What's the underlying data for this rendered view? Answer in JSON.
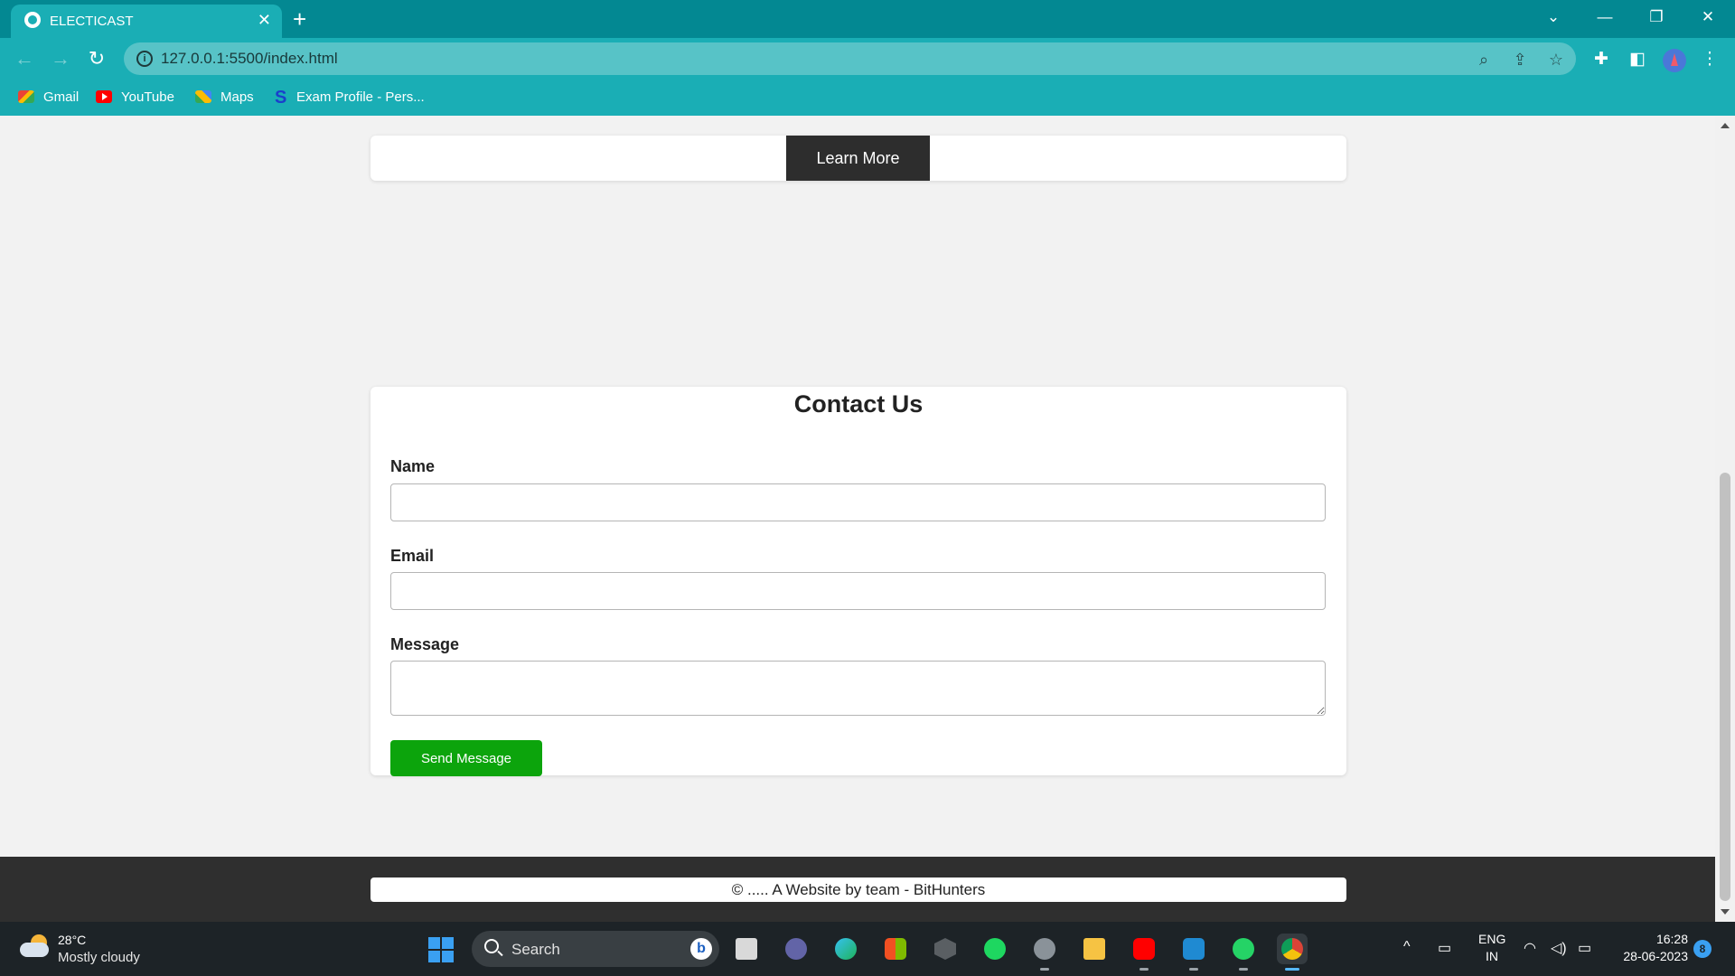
{
  "browser": {
    "tab_title": "ELECTICAST",
    "tab_close": "✕",
    "new_tab": "+",
    "url": "127.0.0.1:5500/index.html",
    "window_controls": {
      "dropdown": "⌄",
      "minimize": "—",
      "restore": "❐",
      "close": "✕"
    },
    "bookmarks": [
      {
        "label": "Gmail",
        "icon": "gmail-icon"
      },
      {
        "label": "YouTube",
        "icon": "youtube-icon"
      },
      {
        "label": "Maps",
        "icon": "maps-icon"
      },
      {
        "label": "Exam Profile - Pers...",
        "icon": "exam-profile-icon"
      }
    ]
  },
  "page": {
    "learn_more_label": "Learn More",
    "contact": {
      "title": "Contact Us",
      "name_label": "Name",
      "name_value": "",
      "email_label": "Email",
      "email_value": "",
      "message_label": "Message",
      "message_value": "",
      "send_label": "Send Message"
    },
    "footer_text": "© ..... A Website by team - BitHunters"
  },
  "taskbar": {
    "weather_temp": "28°C",
    "weather_desc": "Mostly cloudy",
    "search_label": "Search",
    "bing_label": "b",
    "apps": [
      "task-view",
      "teams",
      "edge",
      "store",
      "unity",
      "spotify",
      "settings",
      "file-explorer",
      "youtube",
      "vscode",
      "whatsapp",
      "chrome"
    ],
    "tray_chevron": "^",
    "lang_top": "ENG",
    "lang_bottom": "IN",
    "time": "16:28",
    "date": "28-06-2023",
    "notification_count": "8"
  },
  "colors": {
    "chrome_dark": "#038892",
    "chrome_light": "#1aaeb5",
    "learn_more_bg": "#2d2d2d",
    "send_bg": "#0ca40c",
    "footer_bg": "#2f2f2f",
    "page_bg": "#f2f2f2"
  }
}
